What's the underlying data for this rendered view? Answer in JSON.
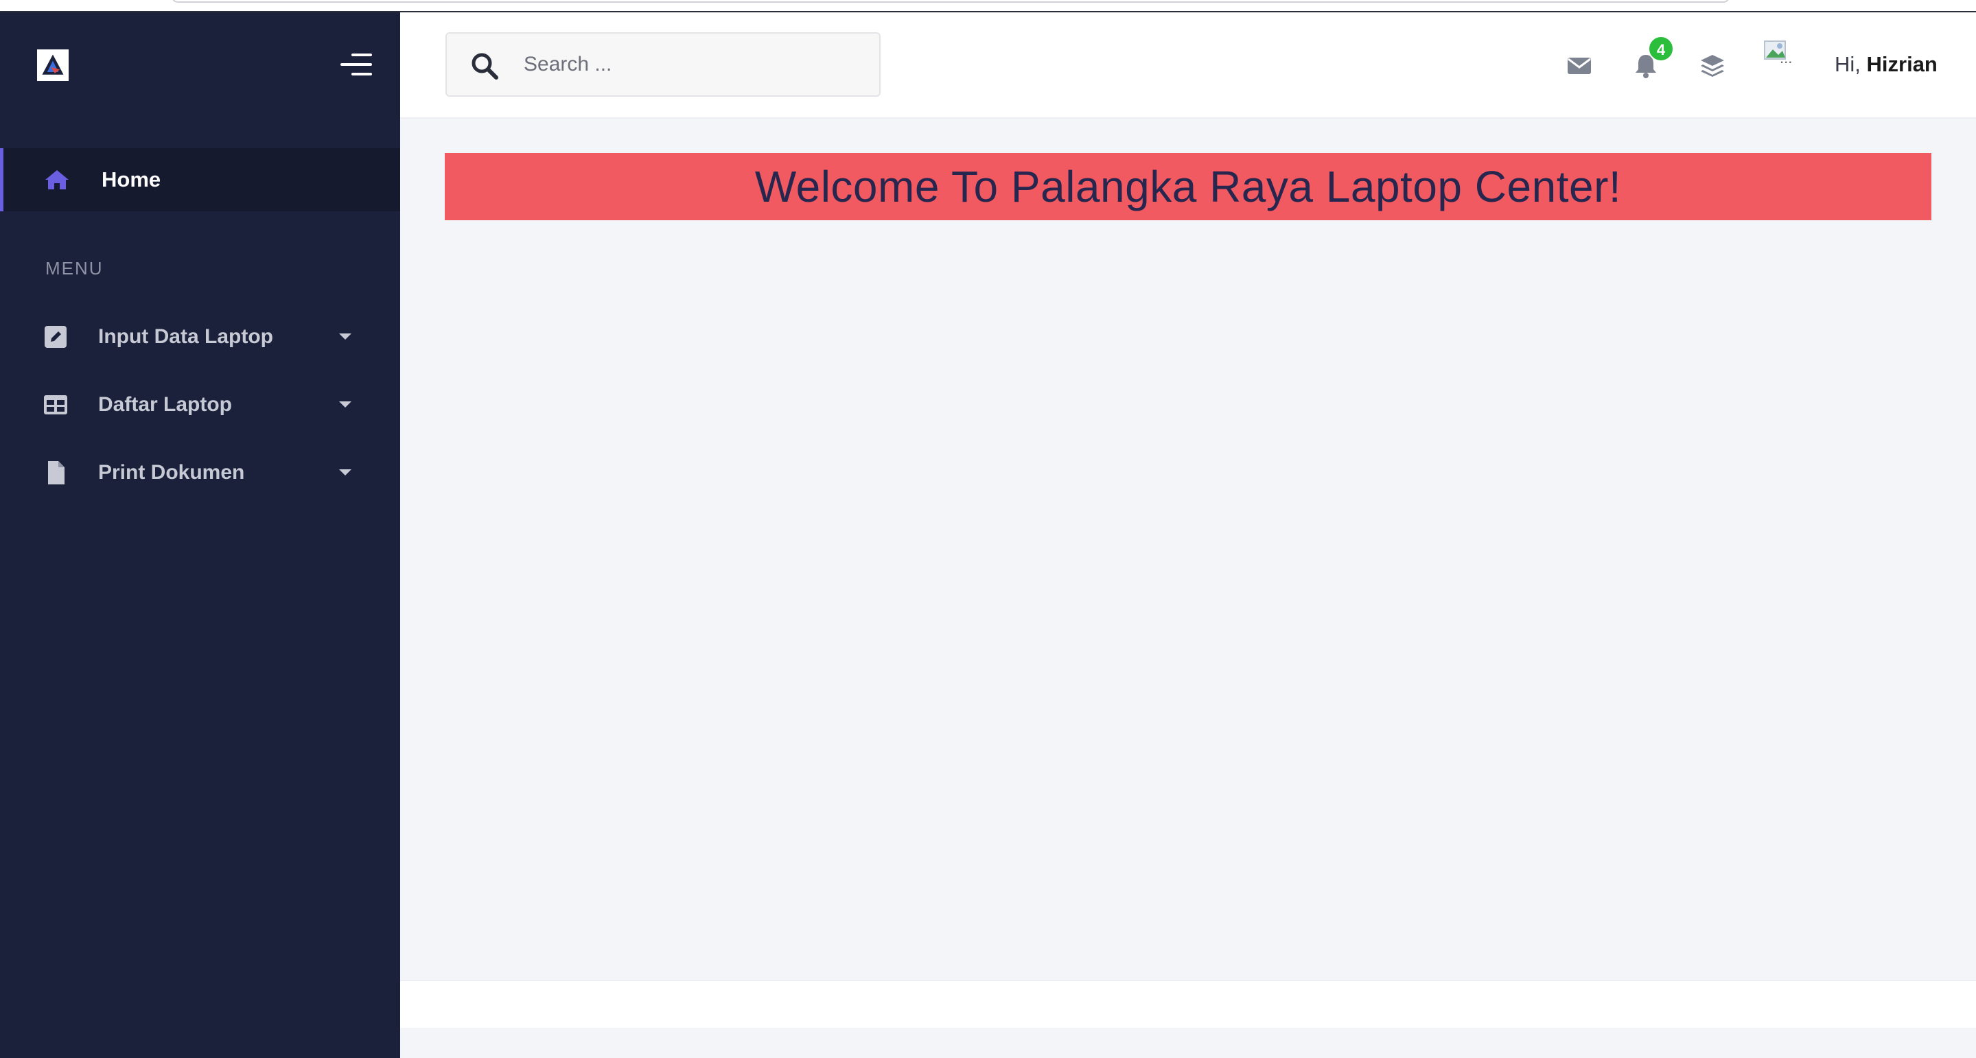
{
  "sidebar": {
    "home_label": "Home",
    "menu_heading": "MENU",
    "items": [
      {
        "label": "Input Data Laptop",
        "icon": "edit-icon"
      },
      {
        "label": "Daftar Laptop",
        "icon": "table-icon"
      },
      {
        "label": "Print Dokumen",
        "icon": "file-icon"
      }
    ]
  },
  "header": {
    "search_placeholder": "Search ...",
    "notification_count": "4",
    "avatar_alt": "...",
    "greeting_prefix": "Hi,",
    "user_name": "Hizrian"
  },
  "main": {
    "banner_text": "Welcome To Palangka Raya Laptop Center!"
  },
  "colors": {
    "sidebar_bg": "#1b213b",
    "accent": "#6a5fe0",
    "banner_bg": "#f25a62",
    "banner_text": "#27264e",
    "badge": "#2bbd3c"
  }
}
